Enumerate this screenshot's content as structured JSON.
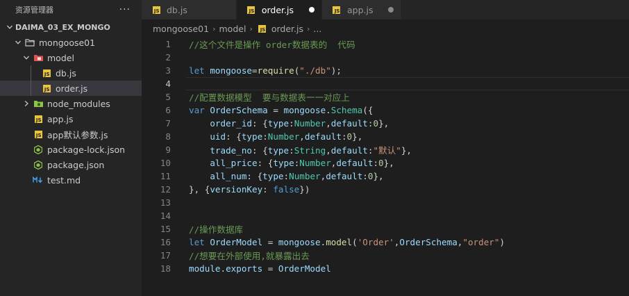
{
  "explorer": {
    "title": "资源管理器",
    "more": "···",
    "tree": [
      {
        "label": "DAIMA_03_EX_MONGO",
        "type": "project",
        "depth": 0,
        "expanded": true
      },
      {
        "label": "mongoose01",
        "type": "folder",
        "depth": 1,
        "expanded": true
      },
      {
        "label": "model",
        "type": "folder-red",
        "depth": 2,
        "expanded": true
      },
      {
        "label": "db.js",
        "type": "js",
        "depth": 3
      },
      {
        "label": "order.js",
        "type": "js",
        "depth": 3,
        "selected": true
      },
      {
        "label": "node_modules",
        "type": "folder-green",
        "depth": 2,
        "expanded": false
      },
      {
        "label": "app.js",
        "type": "js",
        "depth": 2
      },
      {
        "label": "app默认参数.js",
        "type": "js",
        "depth": 2
      },
      {
        "label": "package-lock.json",
        "type": "json",
        "depth": 2
      },
      {
        "label": "package.json",
        "type": "json",
        "depth": 2
      },
      {
        "label": "test.md",
        "type": "md",
        "depth": 2
      }
    ]
  },
  "tabs": [
    {
      "label": "db.js",
      "active": false,
      "dirty": false
    },
    {
      "label": "order.js",
      "active": true,
      "dirty": true
    },
    {
      "label": "app.js",
      "active": false,
      "dirty": true
    }
  ],
  "breadcrumb": [
    "mongoose01",
    "model",
    "order.js",
    "..."
  ],
  "editor": {
    "current_line": 4,
    "lines": [
      {
        "n": "1",
        "tokens": [
          [
            "comment",
            "//这个文件是操作 order数据表的  代码"
          ]
        ]
      },
      {
        "n": "2",
        "tokens": []
      },
      {
        "n": "3",
        "tokens": [
          [
            "kw",
            "let"
          ],
          [
            "punc",
            " "
          ],
          [
            "var",
            "mongoose"
          ],
          [
            "punc",
            "="
          ],
          [
            "fn",
            "require"
          ],
          [
            "punc",
            "("
          ],
          [
            "str",
            "\"./db\""
          ],
          [
            "punc",
            ");"
          ]
        ]
      },
      {
        "n": "4",
        "tokens": []
      },
      {
        "n": "5",
        "tokens": [
          [
            "comment",
            "//配置数据模型  要与数据表一一对应上"
          ]
        ]
      },
      {
        "n": "6",
        "tokens": [
          [
            "kw",
            "var"
          ],
          [
            "punc",
            " "
          ],
          [
            "var",
            "OrderSchema"
          ],
          [
            "punc",
            " = "
          ],
          [
            "var",
            "mongoose"
          ],
          [
            "punc",
            "."
          ],
          [
            "type",
            "Schema"
          ],
          [
            "punc",
            "({"
          ]
        ]
      },
      {
        "n": "7",
        "tokens": [
          [
            "punc",
            "    "
          ],
          [
            "var",
            "order_id"
          ],
          [
            "punc",
            ": {"
          ],
          [
            "var",
            "type"
          ],
          [
            "punc",
            ":"
          ],
          [
            "type",
            "Number"
          ],
          [
            "punc",
            ","
          ],
          [
            "var",
            "default"
          ],
          [
            "punc",
            ":"
          ],
          [
            "num",
            "0"
          ],
          [
            "punc",
            "},"
          ]
        ]
      },
      {
        "n": "8",
        "tokens": [
          [
            "punc",
            "    "
          ],
          [
            "var",
            "uid"
          ],
          [
            "punc",
            ": {"
          ],
          [
            "var",
            "type"
          ],
          [
            "punc",
            ":"
          ],
          [
            "type",
            "Number"
          ],
          [
            "punc",
            ","
          ],
          [
            "var",
            "default"
          ],
          [
            "punc",
            ":"
          ],
          [
            "num",
            "0"
          ],
          [
            "punc",
            "},"
          ]
        ]
      },
      {
        "n": "9",
        "tokens": [
          [
            "punc",
            "    "
          ],
          [
            "var",
            "trade_no"
          ],
          [
            "punc",
            ": {"
          ],
          [
            "var",
            "type"
          ],
          [
            "punc",
            ":"
          ],
          [
            "type",
            "String"
          ],
          [
            "punc",
            ","
          ],
          [
            "var",
            "default"
          ],
          [
            "punc",
            ":"
          ],
          [
            "str",
            "\"默认\""
          ],
          [
            "punc",
            "},"
          ]
        ]
      },
      {
        "n": "10",
        "tokens": [
          [
            "punc",
            "    "
          ],
          [
            "var",
            "all_price"
          ],
          [
            "punc",
            ": {"
          ],
          [
            "var",
            "type"
          ],
          [
            "punc",
            ":"
          ],
          [
            "type",
            "Number"
          ],
          [
            "punc",
            ","
          ],
          [
            "var",
            "default"
          ],
          [
            "punc",
            ":"
          ],
          [
            "num",
            "0"
          ],
          [
            "punc",
            "},"
          ]
        ]
      },
      {
        "n": "11",
        "tokens": [
          [
            "punc",
            "    "
          ],
          [
            "var",
            "all_num"
          ],
          [
            "punc",
            ": {"
          ],
          [
            "var",
            "type"
          ],
          [
            "punc",
            ":"
          ],
          [
            "type",
            "Number"
          ],
          [
            "punc",
            ","
          ],
          [
            "var",
            "default"
          ],
          [
            "punc",
            ":"
          ],
          [
            "num",
            "0"
          ],
          [
            "punc",
            "},"
          ]
        ]
      },
      {
        "n": "12",
        "tokens": [
          [
            "punc",
            "}, {"
          ],
          [
            "var",
            "versionKey"
          ],
          [
            "punc",
            ": "
          ],
          [
            "bool",
            "false"
          ],
          [
            "punc",
            "})"
          ]
        ]
      },
      {
        "n": "13",
        "tokens": []
      },
      {
        "n": "14",
        "tokens": []
      },
      {
        "n": "15",
        "tokens": [
          [
            "comment",
            "//操作数据库"
          ]
        ]
      },
      {
        "n": "16",
        "tokens": [
          [
            "kw",
            "let"
          ],
          [
            "punc",
            " "
          ],
          [
            "var",
            "OrderModel"
          ],
          [
            "punc",
            " = "
          ],
          [
            "var",
            "mongoose"
          ],
          [
            "punc",
            "."
          ],
          [
            "fn",
            "model"
          ],
          [
            "punc",
            "("
          ],
          [
            "str",
            "'Order'"
          ],
          [
            "punc",
            ","
          ],
          [
            "var",
            "OrderSchema"
          ],
          [
            "punc",
            ","
          ],
          [
            "str",
            "\"order\""
          ],
          [
            "punc",
            ")"
          ]
        ]
      },
      {
        "n": "17",
        "tokens": [
          [
            "comment",
            "//想要在外部使用,就暴露出去"
          ]
        ]
      },
      {
        "n": "18",
        "tokens": [
          [
            "var",
            "module"
          ],
          [
            "punc",
            "."
          ],
          [
            "var",
            "exports"
          ],
          [
            "punc",
            " = "
          ],
          [
            "var",
            "OrderModel"
          ]
        ]
      }
    ]
  },
  "colors": {
    "js_icon": "#e8c43f",
    "folder_red": "#e05252",
    "folder_green": "#8bc34a",
    "json_icon": "#8bc34a",
    "md_icon": "#42a5f5"
  }
}
